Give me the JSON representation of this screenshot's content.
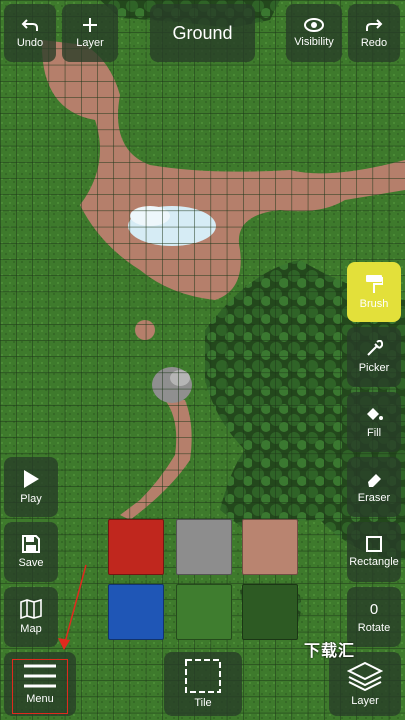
{
  "toolbar": {
    "undo": "Undo",
    "layer_add": "Layer",
    "layer_name": "Ground",
    "visibility": "Visibility",
    "redo": "Redo"
  },
  "right_tools": {
    "brush": "Brush",
    "picker": "Picker",
    "fill": "Fill",
    "eraser": "Eraser",
    "rectangle": "Rectangle",
    "rotate_value": "0",
    "rotate": "Rotate",
    "layer": "Layer"
  },
  "left_tools": {
    "play": "Play",
    "save": "Save",
    "map": "Map",
    "menu": "Menu"
  },
  "bottom": {
    "tile": "Tile"
  },
  "palette": [
    {
      "name": "lava",
      "color": "#c0271e"
    },
    {
      "name": "stone",
      "color": "#8d8d8d"
    },
    {
      "name": "dirt",
      "color": "#b98470"
    },
    {
      "name": "water",
      "color": "#1f56b6"
    },
    {
      "name": "grass",
      "color": "#3f7d2f"
    },
    {
      "name": "bush",
      "color": "#2d5a23"
    }
  ],
  "watermark": "下载汇",
  "colors": {
    "accent_active": "#e3e03a",
    "grass": "#3e7a2c",
    "dirt": "#b57f6b",
    "water": "#d6ecf5",
    "panel": "rgba(40,60,40,0.78)",
    "annotation": "#e02a1e"
  }
}
